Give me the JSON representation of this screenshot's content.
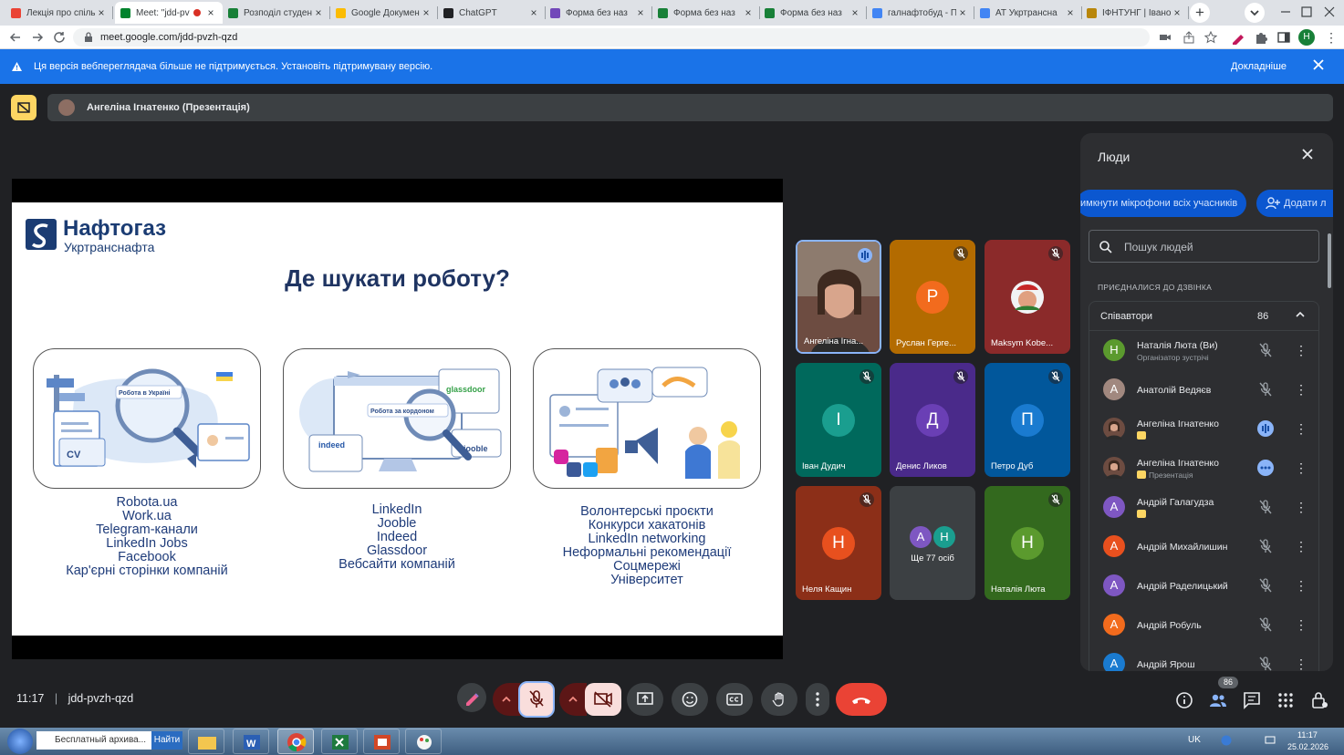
{
  "browser": {
    "tabs": [
      {
        "label": "Лекція про спіль",
        "color": "#ea4335"
      },
      {
        "label": "Meet: \"jdd-pv",
        "color": "#00832d",
        "active": true
      },
      {
        "label": "Розподіл студен",
        "color": "#188038"
      },
      {
        "label": "Google Докумен",
        "color": "#fbbc04"
      },
      {
        "label": "ChatGPT",
        "color": "#202124"
      },
      {
        "label": "Форма без наз",
        "color": "#7248b9"
      },
      {
        "label": "Форма без наз",
        "color": "#188038"
      },
      {
        "label": "Форма без наз",
        "color": "#188038"
      },
      {
        "label": "галнафтобуд - П",
        "color": "#4285f4"
      },
      {
        "label": "АТ Укртрансна",
        "color": "#4285f4"
      },
      {
        "label": "ІФНТУНГ | Івано",
        "color": "#b8860b"
      }
    ],
    "url": "meet.google.com/jdd-pvzh-qzd"
  },
  "banner": {
    "text": "Ця версія веб­переглядача більше не підтримується. Установіть підтримувану версію.",
    "more": "Докладніше"
  },
  "presenter_bar": {
    "text": "Ангеліна Ігнатенко (Презентація)"
  },
  "slide": {
    "logo_line1": "Нафтогаз",
    "logo_line2": "Укртранснафта",
    "title": "Де шукати роботу?",
    "card1_label": "Робота в Україні",
    "card2_label": "Робота за кордоном",
    "card2_brands": [
      "glassdoor",
      "indeed",
      "jooble"
    ],
    "card1_cv": "CV",
    "col1": [
      "Robota.ua",
      "Work.ua",
      "Telegram-канали",
      "LinkedIn Jobs",
      "Facebook",
      "Кар'єрні сторінки компаній"
    ],
    "col2": [
      "LinkedIn",
      "Jooble",
      "Indeed",
      "Glassdoor",
      "Вебсайти компаній"
    ],
    "col3": [
      "Волонтерські проєкти",
      "Конкурси хакатонів",
      "LinkedIn networking",
      "Неформальні рекомендації",
      "Соцмережі",
      "Університет"
    ]
  },
  "tiles": [
    {
      "name": "Ангеліна Ігна...",
      "bg": "#5d4037",
      "video": true,
      "speaking": true
    },
    {
      "name": "Руслан Герге...",
      "bg": "#b36b00",
      "initial": "Р",
      "avatar": "#f26b1d"
    },
    {
      "name": "Maksym Kobe...",
      "bg": "#8b2a2a",
      "photo": true
    },
    {
      "name": "Іван Дудич",
      "bg": "#00695c",
      "initial": "І",
      "avatar": "#1a9e8f"
    },
    {
      "name": "Денис Ликов",
      "bg": "#4a2a8a",
      "initial": "Д",
      "avatar": "#6a3fb5"
    },
    {
      "name": "Петро Дуб",
      "bg": "#01579b",
      "initial": "П",
      "avatar": "#1a7bd0"
    },
    {
      "name": "Неля Кащин",
      "bg": "#8c2f18",
      "initial": "Н",
      "avatar": "#e8501e"
    },
    {
      "name": "Ще 77 осіб",
      "bg": "#3c4043",
      "more": true,
      "initials": [
        "А",
        "Н"
      ]
    },
    {
      "name": "Наталія Люта",
      "bg": "#33691e",
      "initial": "Н",
      "avatar": "#5b9a2e"
    }
  ],
  "people": {
    "title": "Люди",
    "mute_all": "имкнути мікрофони всіх учасників",
    "add": "Додати л",
    "search_placeholder": "Пошук людей",
    "section": "ПРИЄДНАЛИСЯ ДО ДЗВІНКА",
    "group": "Співавтори",
    "count": "86",
    "rows": [
      {
        "name": "Наталія Люта (Ви)",
        "sub": "Організатор зустрічі",
        "initial": "Н",
        "color": "#5b9a2e"
      },
      {
        "name": "Анатолій Ведяєв",
        "sub": "",
        "initial": "А",
        "color": "#a1887f"
      },
      {
        "name": "Ангеліна Ігнатенко",
        "sub": "",
        "initial": "",
        "color": "#6d4c41",
        "badge": true,
        "speaking": true
      },
      {
        "name": "Ангеліна Ігнатенко",
        "sub": "Презентація",
        "initial": "",
        "color": "#6d4c41",
        "badge": true,
        "more": true
      },
      {
        "name": "Андрій Галагудза",
        "sub": "",
        "initial": "А",
        "color": "#7e57c2",
        "badge": true
      },
      {
        "name": "Андрій Михайлишин",
        "sub": "",
        "initial": "А",
        "color": "#e8501e"
      },
      {
        "name": "Андрій Раделицький",
        "sub": "",
        "initial": "А",
        "color": "#7e57c2"
      },
      {
        "name": "Андрій Робуль",
        "sub": "",
        "initial": "А",
        "color": "#f26b1d"
      },
      {
        "name": "Андрій Ярош",
        "sub": "",
        "initial": "А",
        "color": "#1a7bd0"
      }
    ]
  },
  "controls": {
    "time": "11:17",
    "code": "jdd-pvzh-qzd",
    "people_count": "86"
  },
  "taskbar": {
    "search_text": "Бесплатный архива...",
    "search_button": "Найти",
    "lang": "UK",
    "clock_time": "11:17",
    "clock_date": "25.02.2026"
  }
}
